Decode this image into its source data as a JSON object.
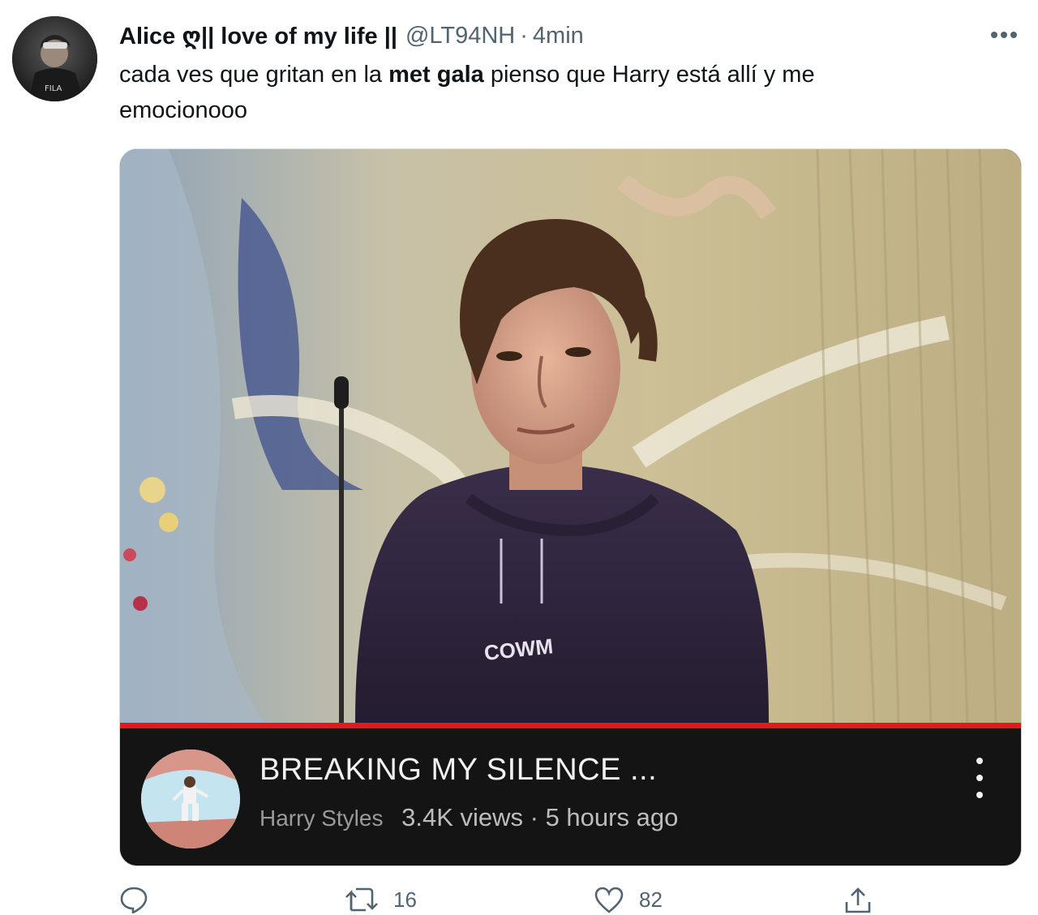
{
  "tweet": {
    "author_name": "Alice ღ|| love of my life ||",
    "handle": "@LT94NH",
    "separator": "·",
    "time": "4min",
    "text_before": "cada ves que gritan en la ",
    "text_bold": "met gala",
    "text_after": " pienso que Harry está allí y me emocionooo",
    "more_icon": "more-horizontal-icon"
  },
  "video_card": {
    "title": "BREAKING MY SILENCE ...",
    "channel": "Harry Styles",
    "views": "3.4K views",
    "meta_separator": "·",
    "age": "5 hours ago",
    "progress_fraction": 1.0,
    "menu_icon": "more-vertical-icon",
    "hoodie_text": "COWM"
  },
  "actions": {
    "reply_icon": "reply-icon",
    "retweet_icon": "retweet-icon",
    "retweet_count": "16",
    "like_icon": "heart-icon",
    "like_count": "82",
    "share_icon": "share-icon"
  },
  "colors": {
    "text_primary": "#0f1419",
    "text_secondary": "#536471",
    "progress_red": "#e01b1b",
    "yt_bar": "#141414"
  }
}
